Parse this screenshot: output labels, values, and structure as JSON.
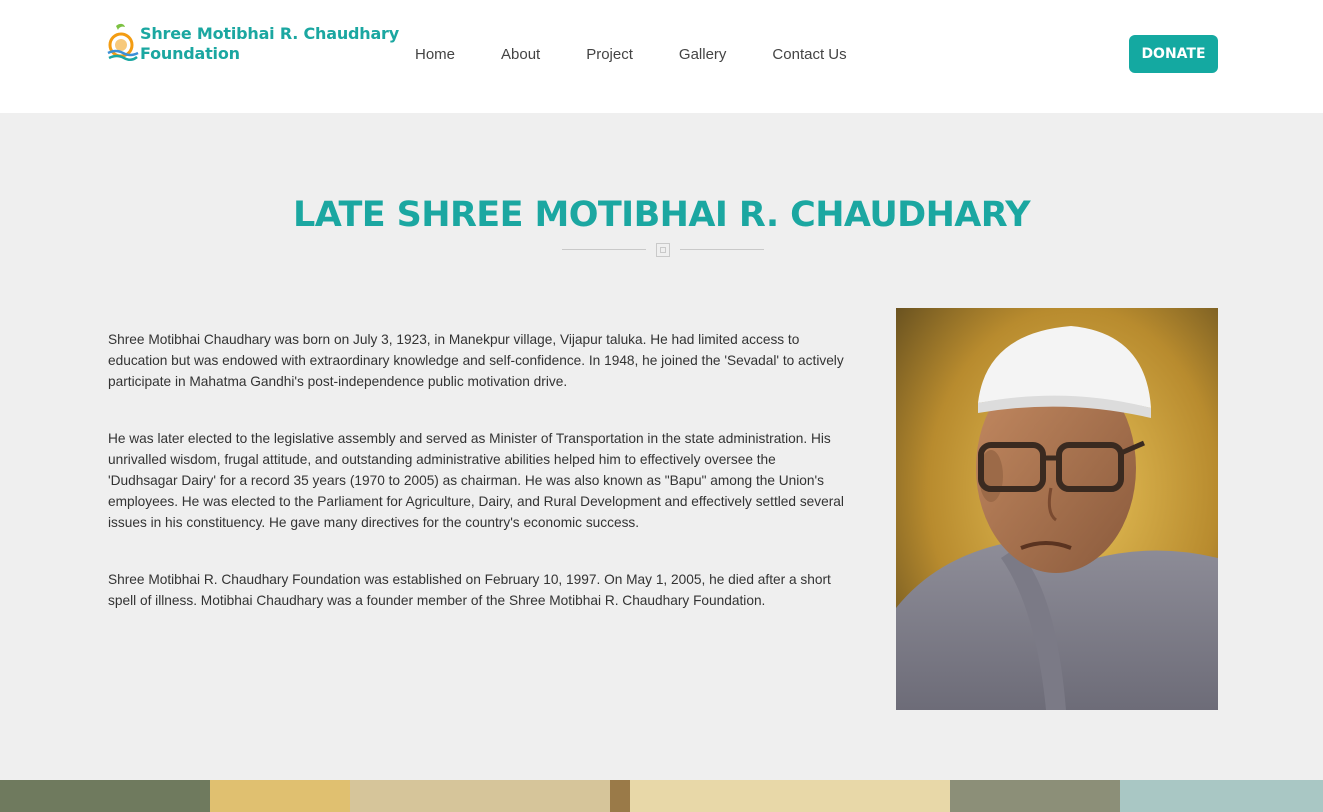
{
  "header": {
    "logo_line1": "Shree Motibhai R. Chaudhary",
    "logo_line2": "Foundation",
    "nav": [
      "Home",
      "About",
      "Project",
      "Gallery",
      "Contact Us"
    ],
    "donate_label": "DONATE"
  },
  "main": {
    "title": "LATE SHREE MOTIBHAI R. CHAUDHARY",
    "paragraphs": [
      "Shree Motibhai Chaudhary was born on July 3, 1923, in Manekpur village, Vijapur taluka. He had limited access to education but was endowed with extraordinary knowledge and self-confidence. In 1948, he joined the 'Sevadal' to actively participate in Mahatma Gandhi's post-independence public motivation drive.",
      "He was later elected to the legislative assembly and served as Minister of Transportation in the state administration. His unrivalled wisdom, frugal attitude, and outstanding administrative abilities helped him to effectively oversee the 'Dudhsagar Dairy' for a record 35 years (1970 to 2005) as chairman. He was also known as \"Bapu\" among the Union's employees. He was elected to the Parliament for Agriculture, Dairy, and Rural Development and effectively settled several issues in his constituency. He gave many directives for the country's economic success.",
      "Shree Motibhai R. Chaudhary Foundation was established on February 10, 1997. On May 1, 2005, he died after a short spell of illness. Motibhai Chaudhary was a founder member of the Shree Motibhai R. Chaudhary Foundation."
    ]
  },
  "colors": {
    "accent": "#1ba7a1",
    "button": "#14a9a1",
    "background": "#efefef"
  }
}
